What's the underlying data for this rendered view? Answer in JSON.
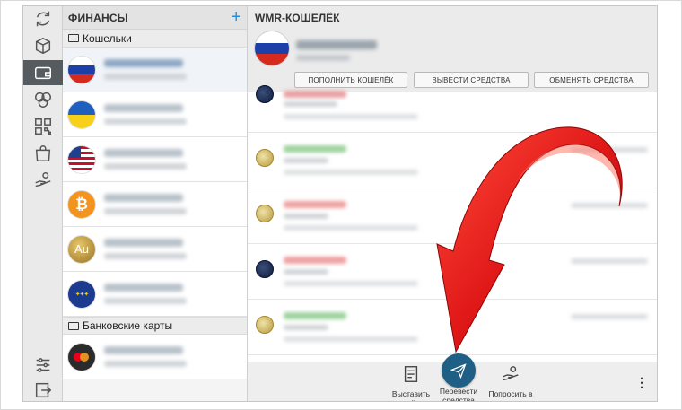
{
  "list": {
    "title": "ФИНАНСЫ",
    "add_icon": "plus-icon",
    "section_wallets": "Кошельки",
    "section_cards": "Банковские карты",
    "wallets": [
      {
        "flag": "russia"
      },
      {
        "flag": "ukraine"
      },
      {
        "flag": "usa"
      },
      {
        "flag": "bitcoin"
      },
      {
        "flag": "gold",
        "badge": "Au"
      },
      {
        "flag": "eu"
      }
    ],
    "cards": [
      {
        "flag": "mastercard"
      }
    ]
  },
  "main": {
    "title": "WMR-КОШЕЛЁК",
    "btn_topup": "ПОПОЛНИТЬ КОШЕЛЁК",
    "btn_withdraw": "ВЫВЕСТИ СРЕДСТВА",
    "btn_exchange": "ОБМЕНЯТЬ СРЕДСТВА"
  },
  "actions": {
    "invoice": "Выставить счёт",
    "transfer": "Перевести средства",
    "loan": "Попросить в долг"
  },
  "colors": {
    "accent": "#2a8fd8",
    "fab": "#1f5f86",
    "arrow": "#e01818",
    "income": "#5cb85c",
    "expense": "#e05050"
  }
}
